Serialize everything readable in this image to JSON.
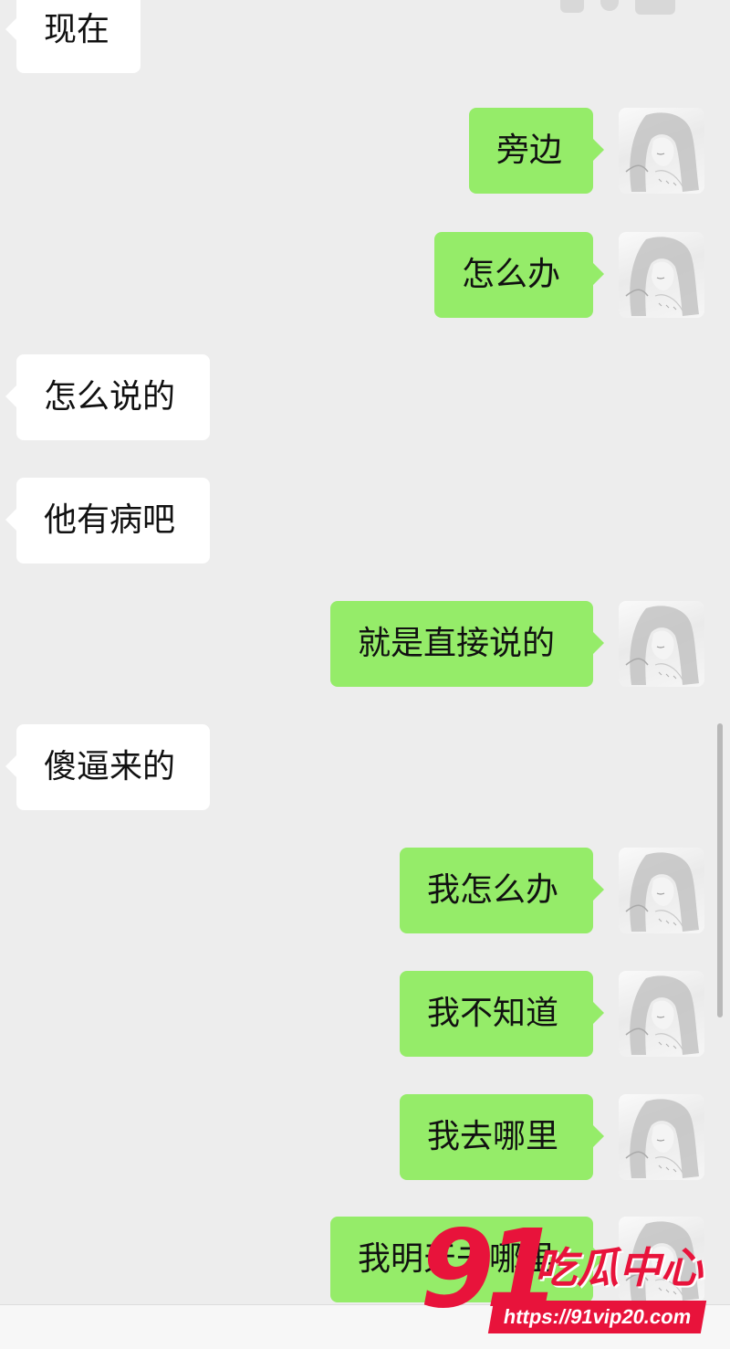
{
  "messages": [
    {
      "side": "in",
      "text": "现在"
    },
    {
      "side": "out",
      "text": "旁边"
    },
    {
      "side": "out",
      "text": "怎么办"
    },
    {
      "side": "in",
      "text": "怎么说的"
    },
    {
      "side": "in",
      "text": "他有病吧"
    },
    {
      "side": "out",
      "text": "就是直接说的"
    },
    {
      "side": "in",
      "text": "傻逼来的"
    },
    {
      "side": "out",
      "text": "我怎么办"
    },
    {
      "side": "out",
      "text": "我不知道"
    },
    {
      "side": "out",
      "text": "我去哪里"
    },
    {
      "side": "out",
      "text": "我明天去哪里"
    }
  ],
  "avatar": {
    "icon": "avatar-girl-sketch-icon"
  },
  "watermark": {
    "number": "91",
    "text": "吃瓜中心",
    "url": "https://91vip20.com",
    "color": "#e8133b"
  },
  "colors": {
    "incoming_bubble": "#ffffff",
    "outgoing_bubble": "#95ec69",
    "background": "#ededed"
  }
}
